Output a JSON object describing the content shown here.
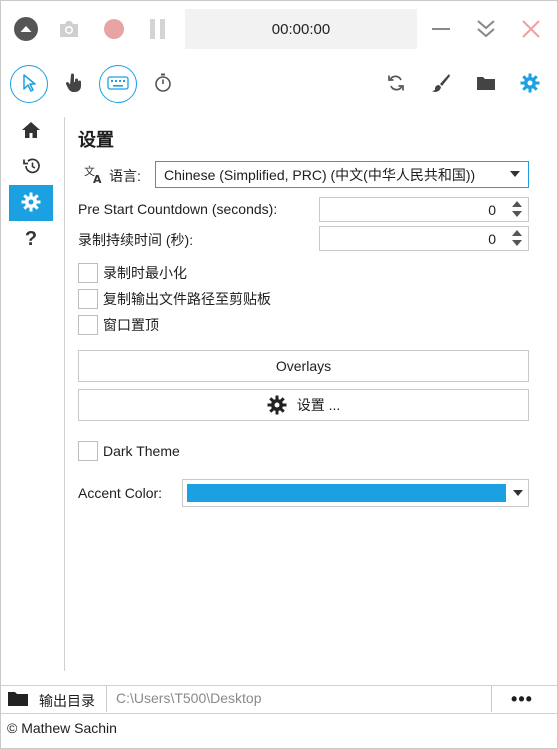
{
  "titlebar": {
    "timer": "00:00:00"
  },
  "colors": {
    "accent": "#1ba1e2",
    "record": "#e8a4a4",
    "close": "#f0a0a0",
    "muted_icon": "#c8c8c8"
  },
  "toolbar": {
    "left_tools": [
      "cursor-icon",
      "hand-pointer-icon",
      "keyboard-icon",
      "stopwatch-icon"
    ],
    "right_tools": [
      "refresh-icon",
      "brush-icon",
      "folder-icon",
      "gear-icon"
    ]
  },
  "sidenav": {
    "items": [
      "home-icon",
      "history-icon",
      "gear-icon",
      "help-icon"
    ],
    "active_index": 2
  },
  "settings": {
    "title": "设置",
    "language_label": "语言:",
    "language_value": "Chinese (Simplified, PRC) (中文(中华人民共和国))",
    "countdown_label": "Pre Start Countdown (seconds):",
    "countdown_value": "0",
    "duration_label": "录制持续时间 (秒):",
    "duration_value": "0",
    "checkboxes": [
      {
        "label": "录制时最小化",
        "checked": false
      },
      {
        "label": "复制输出文件路径至剪贴板",
        "checked": false
      },
      {
        "label": "窗口置顶",
        "checked": false
      }
    ],
    "overlays_button": "Overlays",
    "settings_button": "设置 ...",
    "dark_theme_label": "Dark Theme",
    "dark_theme_checked": false,
    "accent_label": "Accent Color:",
    "accent_value": "#1ba1e2"
  },
  "output": {
    "label": "输出目录",
    "path": "C:\\Users\\T500\\Desktop",
    "more": "•••"
  },
  "status": {
    "copyright": "© Mathew Sachin"
  }
}
